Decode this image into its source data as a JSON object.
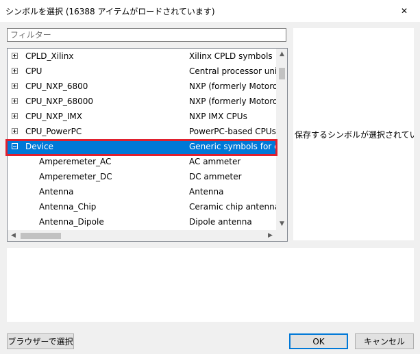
{
  "window": {
    "title": "シンボルを選択 (16388 アイテムがロードされています)",
    "close_glyph": "✕"
  },
  "filter": {
    "placeholder": "フィルター",
    "value": ""
  },
  "tree": {
    "rows": [
      {
        "name": "CPLD_Xilinx",
        "desc": "Xilinx CPLD symbols",
        "level": 0,
        "expanded": false,
        "selected": false
      },
      {
        "name": "CPU",
        "desc": "Central processor unit (C",
        "level": 0,
        "expanded": false,
        "selected": false
      },
      {
        "name": "CPU_NXP_6800",
        "desc": "NXP (formerly Motorola",
        "level": 0,
        "expanded": false,
        "selected": false
      },
      {
        "name": "CPU_NXP_68000",
        "desc": "NXP (formerly Motorola",
        "level": 0,
        "expanded": false,
        "selected": false
      },
      {
        "name": "CPU_NXP_IMX",
        "desc": "NXP IMX CPUs",
        "level": 0,
        "expanded": false,
        "selected": false
      },
      {
        "name": "CPU_PowerPC",
        "desc": "PowerPC-based CPUs",
        "level": 0,
        "expanded": false,
        "selected": false
      },
      {
        "name": "Device",
        "desc": "Generic symbols for con",
        "level": 0,
        "expanded": true,
        "selected": true
      },
      {
        "name": "Amperemeter_AC",
        "desc": "AC ammeter",
        "level": 1,
        "expanded": null,
        "selected": false
      },
      {
        "name": "Amperemeter_DC",
        "desc": "DC ammeter",
        "level": 1,
        "expanded": null,
        "selected": false
      },
      {
        "name": "Antenna",
        "desc": "Antenna",
        "level": 1,
        "expanded": null,
        "selected": false
      },
      {
        "name": "Antenna_Chip",
        "desc": "Ceramic chip antenna w",
        "level": 1,
        "expanded": null,
        "selected": false
      },
      {
        "name": "Antenna_Dipole",
        "desc": "Dipole antenna",
        "level": 1,
        "expanded": null,
        "selected": false
      }
    ],
    "scroll_arrows": {
      "up": "▲",
      "down": "▼",
      "left": "◀",
      "right": "▶"
    }
  },
  "preview": {
    "message": "保存するシンボルが選択されていませ"
  },
  "buttons": {
    "browser": "ブラウザーで選択",
    "ok": "OK",
    "cancel": "キャンセル"
  },
  "colors": {
    "selection": "#0078d7",
    "highlight_border": "#e0202e",
    "dialog_bg": "#f0f0f0"
  }
}
